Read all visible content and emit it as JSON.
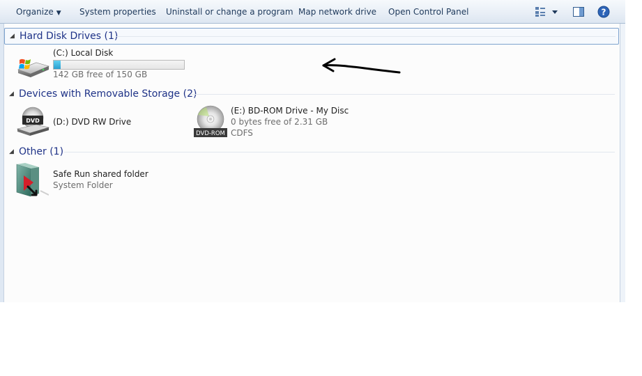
{
  "toolbar": {
    "organize": "Organize",
    "system_properties": "System properties",
    "uninstall": "Uninstall or change a program",
    "map_network": "Map network drive",
    "control_panel": "Open Control Panel"
  },
  "groups": {
    "hard_disk": {
      "title": "Hard Disk Drives (1)",
      "items": [
        {
          "name": "(C:) Local Disk",
          "free": "142 GB free of 150 GB",
          "used_fraction": 0.053,
          "icon": "hard-drive-icon"
        }
      ]
    },
    "removable": {
      "title": "Devices with Removable Storage (2)",
      "items": [
        {
          "name": "(D:) DVD RW Drive",
          "icon": "dvd-drive-icon",
          "badge": "DVD"
        },
        {
          "name": "(E:) BD-ROM Drive - My Disc",
          "free": "0 bytes free of 2.31 GB",
          "fs": "CDFS",
          "icon": "dvd-rom-disc-icon",
          "badge": "DVD-ROM"
        }
      ]
    },
    "other": {
      "title": "Other (1)",
      "items": [
        {
          "name": "Safe Run shared folder",
          "type": "System Folder",
          "icon": "shared-folder-icon"
        }
      ]
    }
  },
  "colors": {
    "group_header": "#1e3287",
    "usage_bar": "#2a9fd0",
    "toolbar_text": "#1e395b"
  }
}
